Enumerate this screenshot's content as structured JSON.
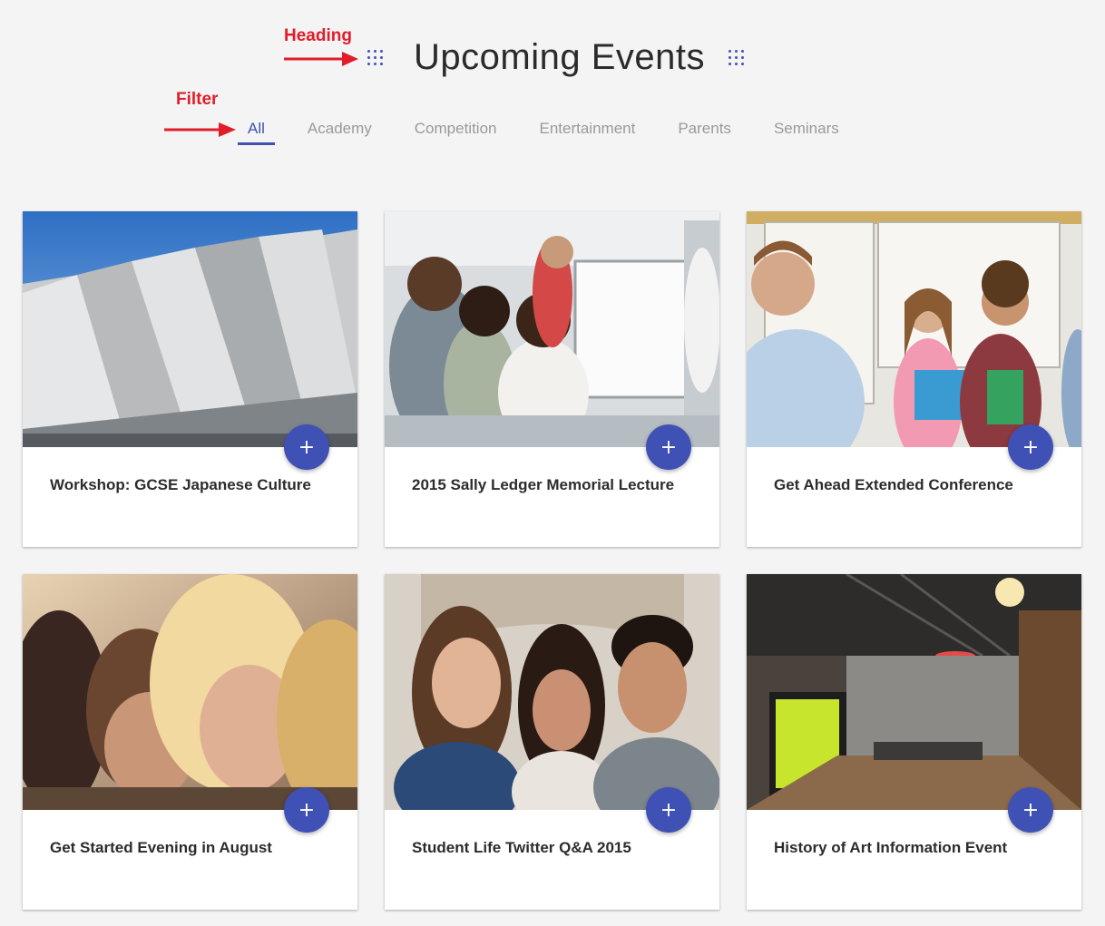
{
  "annotations": {
    "heading_label": "Heading",
    "filter_label": "Filter"
  },
  "heading": {
    "title": "Upcoming Events",
    "accent_color": "#3f51b5"
  },
  "filter": {
    "items": [
      "All",
      "Academy",
      "Competition",
      "Entertainment",
      "Parents",
      "Seminars"
    ],
    "active": "All"
  },
  "events": [
    {
      "title": "Workshop: GCSE Japanese Culture",
      "image": "building-photo",
      "add_label": "+"
    },
    {
      "title": "2015 Sally Ledger Memorial Lecture",
      "image": "students-whiteboard-photo",
      "add_label": "+"
    },
    {
      "title": "Get Ahead Extended Conference",
      "image": "teacher-students-photo",
      "add_label": "+"
    },
    {
      "title": "Get Started Evening in August",
      "image": "students-studying-photo",
      "add_label": "+"
    },
    {
      "title": "Student Life Twitter Q&A 2015",
      "image": "friends-selfie-photo",
      "add_label": "+"
    },
    {
      "title": "History of Art Information Event",
      "image": "office-interior-photo",
      "add_label": "+"
    }
  ],
  "colors": {
    "annotation": "#e11d2a",
    "accent": "#3f51b5",
    "background": "#f4f4f4"
  }
}
